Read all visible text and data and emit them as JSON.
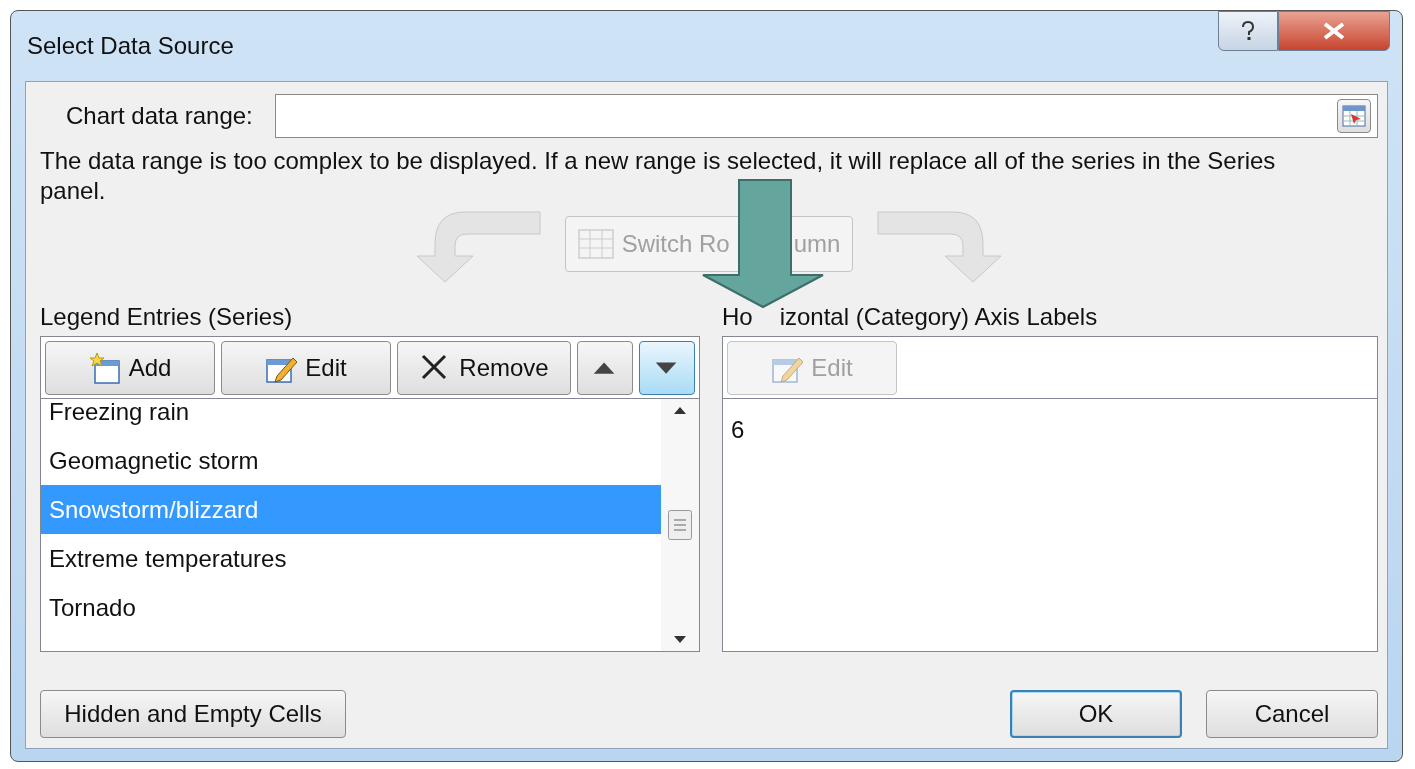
{
  "window": {
    "title": "Select Data Source"
  },
  "chart_data_range": {
    "label": "Chart data range:"
  },
  "message": "The data range is too complex to be displayed. If a new range is selected, it will replace all of the series in the Series panel.",
  "switch_button": {
    "label_parts": [
      "Switch Ro",
      "umn"
    ],
    "disabled": true
  },
  "legend_entries": {
    "heading": "Legend Entries (Series)",
    "buttons": [
      {
        "kind": "add",
        "label": "Add",
        "highlighted": false
      },
      {
        "kind": "edit",
        "label": "Edit",
        "highlighted": false
      },
      {
        "kind": "remove",
        "label": "Remove",
        "highlighted": false
      },
      {
        "kind": "up",
        "highlighted": false
      },
      {
        "kind": "down",
        "highlighted": true
      }
    ],
    "items": [
      {
        "label": "Freezing rain",
        "selected": false
      },
      {
        "label": "Geomagnetic storm",
        "selected": false
      },
      {
        "label": "Snowstorm/blizzard",
        "selected": true
      },
      {
        "label": "Extreme temperatures",
        "selected": false
      },
      {
        "label": "Tornado",
        "selected": false
      }
    ]
  },
  "axis_labels": {
    "heading_parts": [
      "Ho",
      "izontal (Category) Axis Labels"
    ],
    "edit_button": {
      "label": "Edit",
      "disabled": true
    },
    "items": [
      "6"
    ]
  },
  "footer_buttons": [
    {
      "label": "Hidden and Empty Cells",
      "default": false
    },
    {
      "label": "OK",
      "default": true
    },
    {
      "label": "Cancel",
      "default": false
    }
  ]
}
